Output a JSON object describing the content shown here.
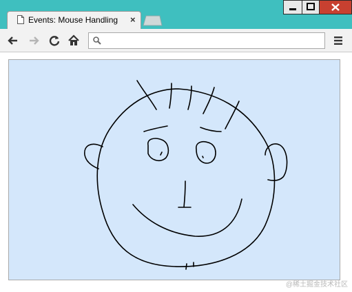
{
  "browser": {
    "tab": {
      "title": "Events: Mouse Handling",
      "close_glyph": "×",
      "icon": "document-icon"
    },
    "window_controls": {
      "minimize_icon": "minimize-icon",
      "maximize_icon": "maximize-icon",
      "close_icon": "close-icon"
    },
    "toolbar": {
      "back_icon": "arrow-left-icon",
      "forward_icon": "arrow-right-icon",
      "reload_icon": "reload-icon",
      "home_icon": "home-icon",
      "menu_icon": "hamburger-menu-icon"
    },
    "omnibox": {
      "value": "",
      "search_icon": "search-icon"
    }
  },
  "page": {
    "canvas": {
      "background": "#d4e7fb",
      "stroke_color": "#000000",
      "drawing": "smiley-face-doodle"
    }
  },
  "watermark": "@稀土掘金技术社区",
  "colors": {
    "frame": "#3fbfbf",
    "window_close": "#c84030"
  }
}
